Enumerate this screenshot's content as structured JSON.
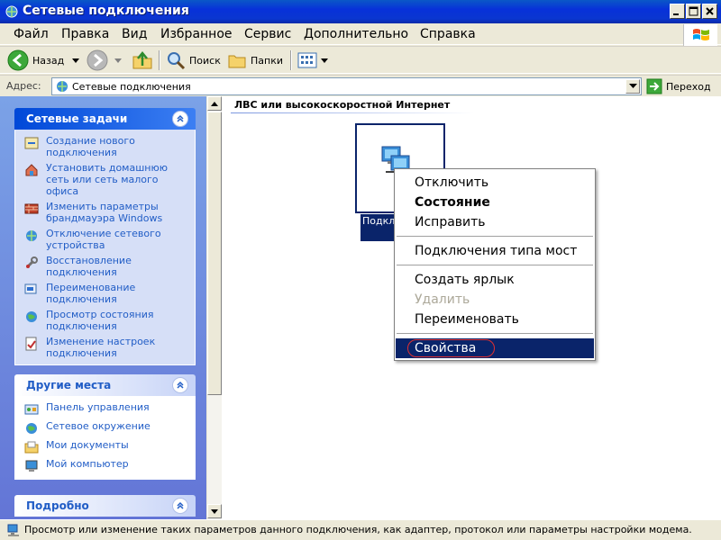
{
  "window": {
    "title": "Сетевые подключения"
  },
  "menu": [
    "Файл",
    "Правка",
    "Вид",
    "Избранное",
    "Сервис",
    "Дополнительно",
    "Справка"
  ],
  "toolbar": {
    "back_label": "Назад",
    "search_label": "Поиск",
    "folders_label": "Папки"
  },
  "address": {
    "label": "Адрес:",
    "value": "Сетевые подключения",
    "go_label": "Переход"
  },
  "network_tasks": {
    "title": "Сетевые задачи",
    "items": [
      "Создание нового подключения",
      "Установить домашнюю сеть или сеть малого офиса",
      "Изменить параметры брандмауэра Windows",
      "Отключение сетевого устройства",
      "Восстановление подключения",
      "Переименование подключения",
      "Просмотр состояния подключения",
      "Изменение настроек подключения"
    ]
  },
  "other_places": {
    "title": "Другие места",
    "items": [
      "Панель управления",
      "Сетевое окружение",
      "Мои документы",
      "Мой компьютер"
    ]
  },
  "details": {
    "title": "Подробно"
  },
  "content": {
    "group_title": "ЛВС или высокоскоростной Интернет",
    "item_label": "Подключение по локальной сети"
  },
  "context_menu": {
    "items": [
      "Отключить",
      "Состояние",
      "Исправить",
      "Подключения типа мост",
      "Создать ярлык",
      "Удалить",
      "Переименовать",
      "Свойства"
    ]
  },
  "status": {
    "text": "Просмотр или изменение таких параметров данного подключения, как адаптер, протокол или параметры настройки модема."
  }
}
